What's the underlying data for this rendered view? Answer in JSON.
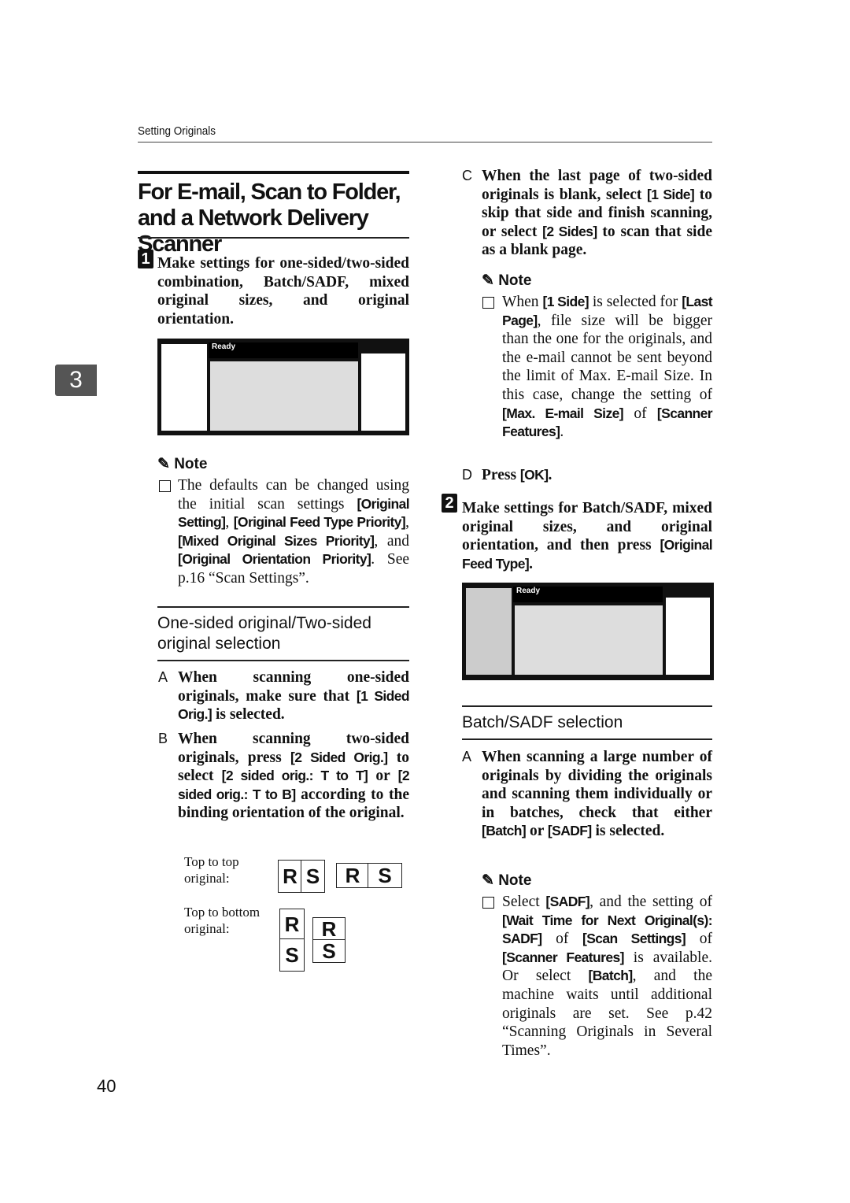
{
  "header": {
    "section": "Setting Originals",
    "chapter": "3",
    "page_number": "40"
  },
  "title": "For E-mail, Scan to Folder, and a Network Delivery Scanner",
  "step1": {
    "num": "1",
    "text": [
      {
        "t": "Make settings for one-sided/two-sided combination, Batch/SADF, mixed original sizes, and original orientation."
      }
    ]
  },
  "panel1": {
    "status": "Ready"
  },
  "note1": {
    "label": "Note",
    "text": [
      {
        "t": "The defaults can be changed using the initial scan settings "
      },
      {
        "t": "[Original Setting]",
        "k": 1
      },
      {
        "t": ", "
      },
      {
        "t": "[Original Feed Type Priority]",
        "k": 1
      },
      {
        "t": ", "
      },
      {
        "t": "[Mixed Original Sizes Priority]",
        "k": 1
      },
      {
        "t": ", and "
      },
      {
        "t": "[Original Orientation Priority]",
        "k": 1
      },
      {
        "t": ". See p.16 “Scan Settings”."
      }
    ]
  },
  "section1": {
    "heading": "One-sided original/Two-sided original selection",
    "items": [
      {
        "mark": "A",
        "text": [
          {
            "t": "When scanning one-sided originals, make sure that "
          },
          {
            "t": "[1 Sided Orig.]",
            "k": 1
          },
          {
            "t": " is selected."
          }
        ]
      },
      {
        "mark": "B",
        "text": [
          {
            "t": "When scanning two-sided originals, press "
          },
          {
            "t": "[2 Sided Orig.]",
            "k": 1
          },
          {
            "t": " to select "
          },
          {
            "t": "[2 sided orig.: T to T]",
            "k": 1
          },
          {
            "t": " or "
          },
          {
            "t": "[2 sided orig.: T to B]",
            "k": 1
          },
          {
            "t": " according to the binding orientation of the original."
          }
        ]
      }
    ],
    "fig": {
      "top_to_top": "Top to top original:",
      "top_to_bottom": "Top to bottom original:",
      "letters": [
        "R",
        "S"
      ]
    }
  },
  "right": {
    "itemC": {
      "mark": "C",
      "text": [
        {
          "t": "When the last page of two-sided originals is blank, select "
        },
        {
          "t": "[1 Side]",
          "k": 1
        },
        {
          "t": " to skip that side and finish scanning, or select "
        },
        {
          "t": "[2 Sides]",
          "k": 1
        },
        {
          "t": " to scan that side as a blank page."
        }
      ]
    },
    "note2": {
      "label": "Note",
      "text": [
        {
          "t": "When "
        },
        {
          "t": "[1 Side]",
          "k": 1
        },
        {
          "t": " is selected for "
        },
        {
          "t": "[Last Page]",
          "k": 1
        },
        {
          "t": ", file size will be bigger than the one for the originals, and the e-mail cannot be sent beyond the limit of Max. E-mail Size. In this case, change the setting of "
        },
        {
          "t": "[Max. E-mail Size]",
          "k": 1
        },
        {
          "t": " of "
        },
        {
          "t": "[Scanner Features]",
          "k": 1
        },
        {
          "t": "."
        }
      ]
    },
    "itemD": {
      "mark": "D",
      "text": [
        {
          "t": "Press "
        },
        {
          "t": "[OK]",
          "k": 1
        },
        {
          "t": "."
        }
      ]
    },
    "step2": {
      "num": "2",
      "text": [
        {
          "t": "Make settings for Batch/SADF, mixed original sizes, and original orientation, and then press "
        },
        {
          "t": "[Original Feed Type]",
          "k": 1
        },
        {
          "t": "."
        }
      ]
    },
    "panel2": {
      "status": "Ready"
    },
    "section2": {
      "heading": "Batch/SADF selection",
      "itemA": {
        "mark": "A",
        "text": [
          {
            "t": "When scanning a large number of originals by dividing the originals and scanning them individually or in batches, check that either "
          },
          {
            "t": "[Batch]",
            "k": 1
          },
          {
            "t": " or "
          },
          {
            "t": "[SADF]",
            "k": 1
          },
          {
            "t": " is selected."
          }
        ]
      },
      "note3": {
        "label": "Note",
        "text": [
          {
            "t": "Select "
          },
          {
            "t": "[SADF]",
            "k": 1
          },
          {
            "t": ", and the setting of "
          },
          {
            "t": "[Wait Time for Next Original(s): SADF]",
            "k": 1
          },
          {
            "t": " of "
          },
          {
            "t": "[Scan Settings]",
            "k": 1
          },
          {
            "t": " of "
          },
          {
            "t": "[Scanner Features]",
            "k": 1
          },
          {
            "t": " is available. Or select "
          },
          {
            "t": "[Batch]",
            "k": 1
          },
          {
            "t": ", and the machine waits until additional originals are set. See p.42 “Scanning Originals in Several Times”."
          }
        ]
      }
    }
  }
}
